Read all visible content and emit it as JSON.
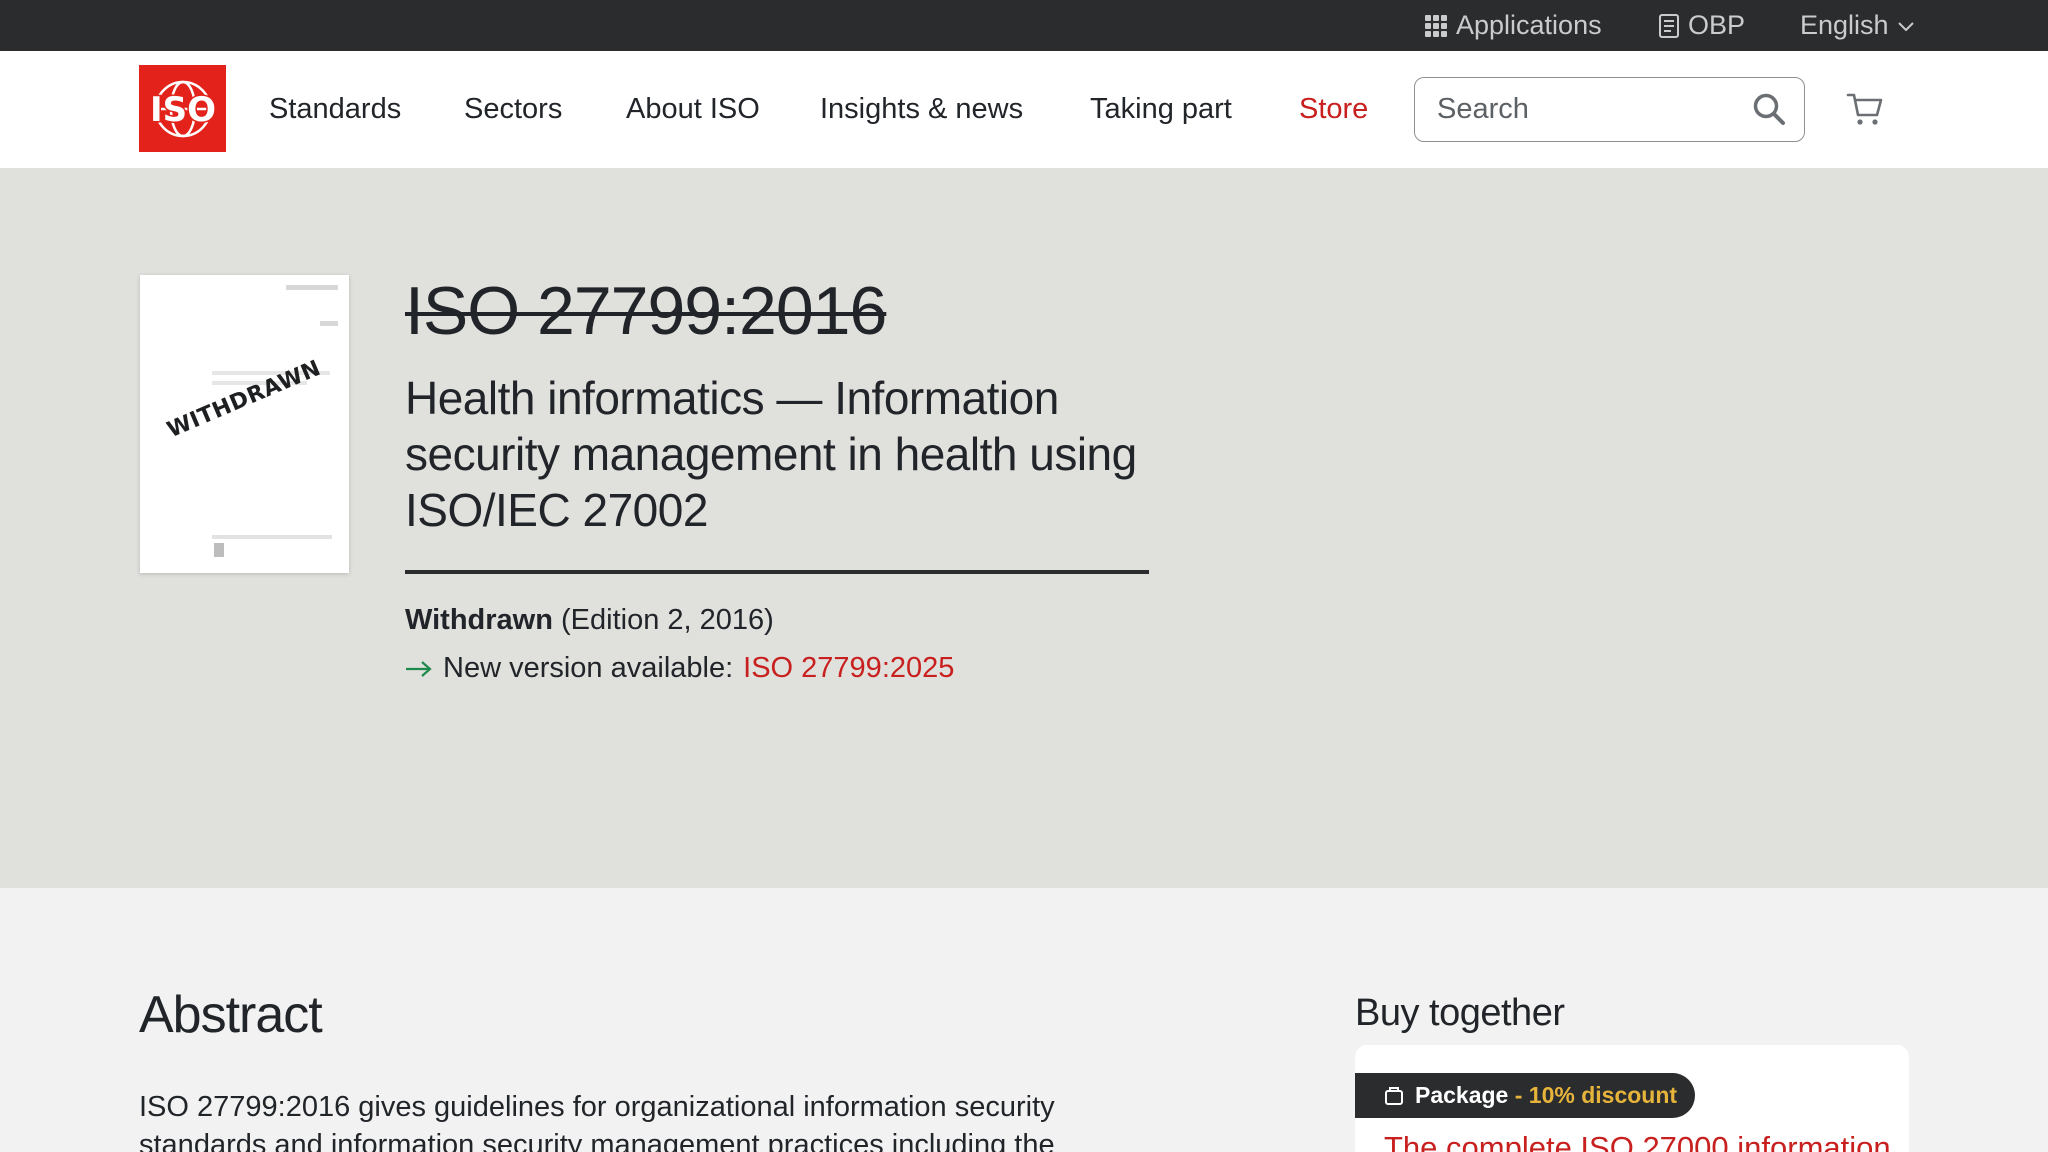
{
  "topbar": {
    "applications": "Applications",
    "obp": "OBP",
    "language": "English"
  },
  "logo": {
    "text": "ISO",
    "color": "#e3231b"
  },
  "nav": {
    "standards": "Standards",
    "sectors": "Sectors",
    "about": "About ISO",
    "insights": "Insights & news",
    "taking_part": "Taking part",
    "store": "Store"
  },
  "search": {
    "placeholder": "Search"
  },
  "cover": {
    "stamp": "WITHDRAWN"
  },
  "standard": {
    "id": "ISO 27799:2016",
    "title": "Health informatics — Information security management in health using ISO/IEC 27002",
    "status": "Withdrawn",
    "edition": "(Edition 2, 2016)",
    "new_version_label": "New version available:",
    "new_version_link": "ISO 27799:2025"
  },
  "abstract": {
    "heading": "Abstract",
    "text": "ISO 27799:2016 gives guidelines for organizational information security standards and information security management practices including the"
  },
  "buy_together": {
    "heading": "Buy together",
    "badge_label": "Package",
    "badge_discount": " - 10% discount",
    "package_title": "The complete ISO 27000 information"
  },
  "colors": {
    "accent_red": "#c8201e",
    "topbar_bg": "#2b2c2e",
    "hero_bg": "#e0e0dd",
    "arrow_green": "#1e8a4c",
    "discount_gold": "#e7b43b"
  }
}
